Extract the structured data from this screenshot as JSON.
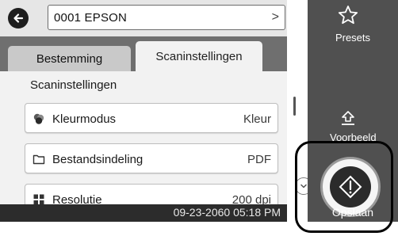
{
  "header": {
    "destination_value": "0001 EPSON",
    "destination_chevron": ">"
  },
  "tabs": [
    {
      "label": "Bestemming",
      "selected": false
    },
    {
      "label": "Scaninstellingen",
      "selected": true
    }
  ],
  "main": {
    "section_title": "Scaninstellingen",
    "settings": [
      {
        "label": "Kleurmodus",
        "value": "Kleur",
        "icon": "color-mode-icon"
      },
      {
        "label": "Bestandsindeling",
        "value": "PDF",
        "icon": "folder-icon"
      },
      {
        "label": "Resolutie",
        "value": "200 dpi",
        "icon": "resolution-icon"
      }
    ]
  },
  "status": {
    "datetime": "09-23-2060 05:18 PM"
  },
  "side": {
    "presets_label": "Presets",
    "preview_label": "Voorbeeld",
    "save_label": "Opslaan"
  },
  "colors": {
    "side_panel": "#505050",
    "tab_bar": "#6f6f6f",
    "status_bar": "#2c2c2c",
    "highlight": "#000000"
  }
}
